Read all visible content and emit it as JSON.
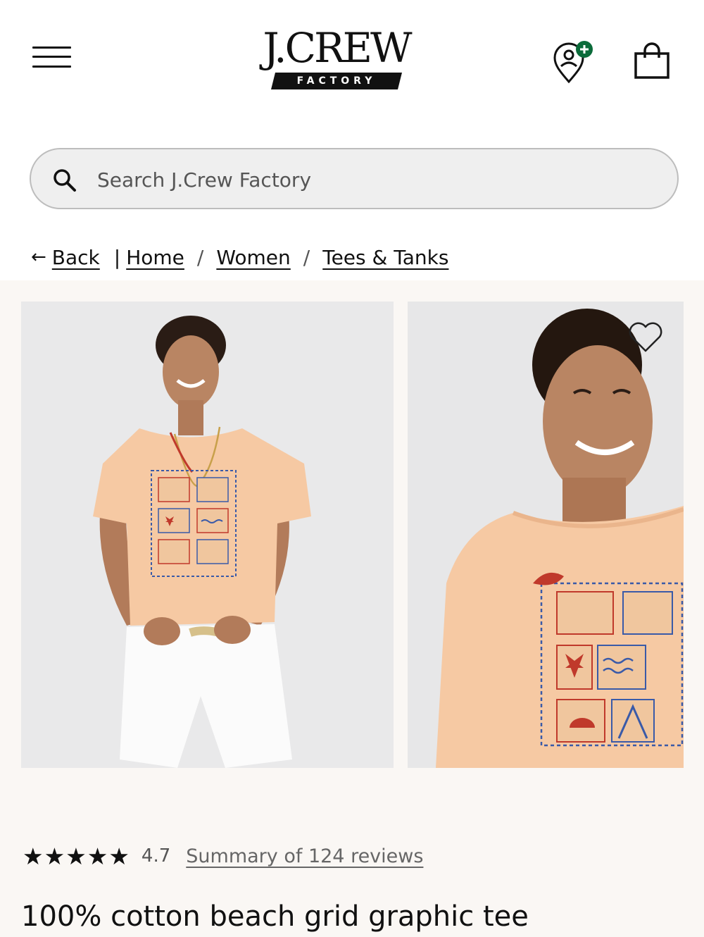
{
  "brand": {
    "name": "J.CREW",
    "sub": "FACTORY"
  },
  "search": {
    "placeholder": "Search J.Crew Factory"
  },
  "breadcrumb": {
    "back_arrow": "←",
    "back": "Back",
    "pipe": "|",
    "separator": "/",
    "items": [
      "Home",
      "Women",
      "Tees & Tanks"
    ]
  },
  "icons": {
    "menu": "hamburger-menu-icon",
    "location": "store-locator-icon",
    "bag": "shopping-bag-icon",
    "search": "search-icon",
    "favorite": "heart-icon"
  },
  "reviews": {
    "stars": "★★★★★",
    "rating_value": 4.7,
    "rating": "4.7",
    "link": "Summary of 124 reviews"
  },
  "product": {
    "title": "100% cotton beach grid graphic tee"
  },
  "colors": {
    "accent_green": "#0b6b3a",
    "gallery_bg": "#faf7f4",
    "tee_peach": "#f6c9a3"
  }
}
